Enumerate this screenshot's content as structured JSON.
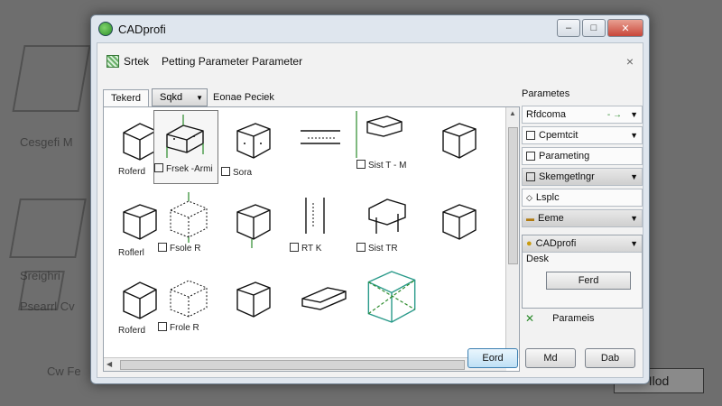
{
  "background": {
    "labels": [
      "Cesgefi M",
      "Sreighri",
      "Psearrl Cv",
      "Cw Fe"
    ],
    "button": "Ilod"
  },
  "window": {
    "title": "CADprofi",
    "controls": {
      "minimize": "–",
      "maximize": "□",
      "close": "✕"
    }
  },
  "dialog": {
    "header_label": "Srtek",
    "header_title": "Petting Parameter Parameter",
    "close_glyph": "×",
    "tabs": {
      "tab1": "Tekerd",
      "tab2_select": "Sqkd",
      "tab3": "Eonae Peciek"
    },
    "grid": {
      "captions": {
        "r0c0": "Roferd",
        "r0c1": "Frsek -Armi",
        "r0c2": "Sora",
        "r0c3": "",
        "r0c4": "Sist T - M",
        "r0c5": "",
        "r1c0": "Roflerl",
        "r1c1": "Fsole R",
        "r1c2": "",
        "r1c3": "RT K",
        "r1c4": "Sist TR",
        "r1c5": "",
        "r2c0": "Roferd",
        "r2c1": "Frole R",
        "r2c2": "",
        "r2c3": "",
        "r2c4": "",
        "r2c5": ""
      }
    },
    "props": {
      "title": "Parametes",
      "row1": "Rfdcoma",
      "row2": "Cpemtcit",
      "row3": "Parameting",
      "row4": "Skemgetlngr",
      "row5": "Lsplc",
      "row6": "Eeme",
      "box_header": "CADprofi",
      "box_line": "Desk",
      "box_button": "Ferd",
      "foot_label": "Parameis"
    },
    "buttons": {
      "ok": "Eord",
      "mid": "Md",
      "cancel": "Dab"
    }
  }
}
